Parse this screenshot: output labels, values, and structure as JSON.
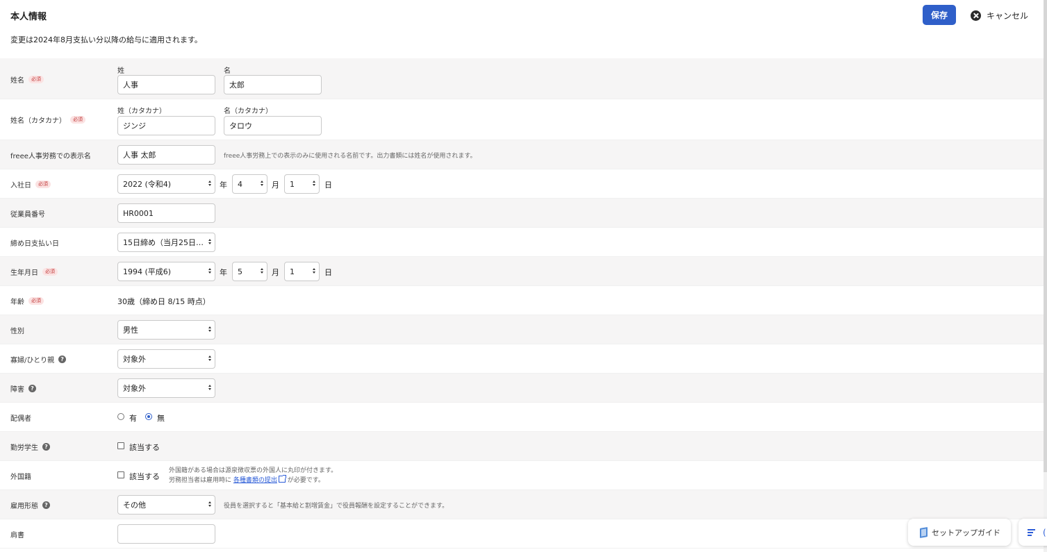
{
  "header": {
    "title": "本人情報",
    "notice": "変更は2024年8月支払い分以降の給与に適用されます。",
    "save_label": "保存",
    "cancel_label": "キャンセル"
  },
  "required_badge": "必須",
  "fields": {
    "name": {
      "label": "姓名",
      "last_label": "姓",
      "first_label": "名",
      "last_value": "人事",
      "first_value": "太郎"
    },
    "name_kana": {
      "label": "姓名（カタカナ）",
      "last_label": "姓（カタカナ）",
      "first_label": "名（カタカナ）",
      "last_value": "ジンジ",
      "first_value": "タロウ"
    },
    "display_name": {
      "label": "freee人事労務での表示名",
      "value": "人事 太郎",
      "hint": "freee人事労務上での表示のみに使用される名前です。出力書類には姓名が使用されます。"
    },
    "hire_date": {
      "label": "入社日",
      "year": "2022 (令和4)",
      "month": "4",
      "day": "1",
      "year_unit": "年",
      "month_unit": "月",
      "day_unit": "日"
    },
    "employee_number": {
      "label": "従業員番号",
      "value": "HR0001"
    },
    "pay_cycle": {
      "label": "締め日支払い日",
      "value": "15日締め（当月25日…"
    },
    "birth_date": {
      "label": "生年月日",
      "year": "1994 (平成6)",
      "month": "5",
      "day": "1",
      "year_unit": "年",
      "month_unit": "月",
      "day_unit": "日"
    },
    "age": {
      "label": "年齢",
      "value": "30歳（締め日 8/15 時点）"
    },
    "gender": {
      "label": "性別",
      "value": "男性"
    },
    "widow": {
      "label": "寡婦/ひとり親",
      "value": "対象外"
    },
    "disability": {
      "label": "障害",
      "value": "対象外"
    },
    "spouse": {
      "label": "配偶者",
      "option_yes": "有",
      "option_no": "無",
      "selected": "無"
    },
    "working_student": {
      "label": "勤労学生",
      "checkbox_label": "該当する",
      "checked": false
    },
    "foreign_nationality": {
      "label": "外国籍",
      "checkbox_label": "該当する",
      "checked": false,
      "hint_line1": "外国籍がある場合は源泉徴収票の外国人に丸印が付きます。",
      "hint_line2_prefix": "労務担当者は雇用時に",
      "hint_link": "各種書類の提出",
      "hint_line2_suffix": "が必要です。"
    },
    "employment_type": {
      "label": "雇用形態",
      "value": "その他",
      "hint": "役員を選択すると「基本給と割増賃金」で役員報酬を設定することができます。"
    },
    "position": {
      "label": "肩書",
      "value": ""
    }
  },
  "floating": {
    "setup_guide": "セットアップガイド",
    "second_button_text": "("
  }
}
